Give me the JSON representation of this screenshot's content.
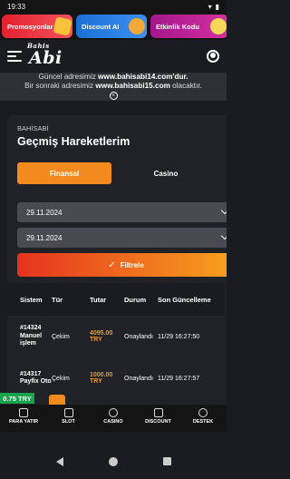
{
  "status": {
    "time": "19:33"
  },
  "promos": [
    "Promosyonlar",
    "Discount AI",
    "Etkinlik Kodu"
  ],
  "header": {
    "logo_top": "Bahis",
    "logo": "Abi"
  },
  "notice": {
    "line1_prefix": "Güncel adresimiz",
    "line1_url": "www.bahisabi14.com",
    "line1_suffix": "'dur.",
    "line2_prefix": "Bir sonraki adresimiz",
    "line2_url": "www.bahisabi15.com",
    "line2_suffix": "olacaktır."
  },
  "page": {
    "breadcrumb": "BAHİSABİ",
    "title": "Geçmiş Hareketlerim"
  },
  "tabs": {
    "active": "Finansal",
    "inactive": "Casino"
  },
  "filters": {
    "date_from": "29.11.2024",
    "date_to": "29.11.2024",
    "button": "Filtrele"
  },
  "table": {
    "headers": [
      "Sistem",
      "Tür",
      "Tutar",
      "Durum",
      "Son Güncelleme"
    ],
    "rows": [
      {
        "sistem": "#14324 Manuel işlem",
        "tur": "Çekim",
        "tutar": "4095.00 TRY",
        "durum": "Onaylandı",
        "guncelleme": "11/29 16:27:50"
      },
      {
        "sistem": "#14317 Payfix Oto",
        "tur": "Çekim",
        "tutar": "1000.00 TRY",
        "durum": "Onaylandı",
        "guncelleme": "11/29 16:27:57"
      }
    ]
  },
  "balance": "0.75 TRY",
  "bottom_nav": [
    "PARA YATIR",
    "SLOT",
    "CASINO",
    "DISCOUNT",
    "DESTEK"
  ]
}
